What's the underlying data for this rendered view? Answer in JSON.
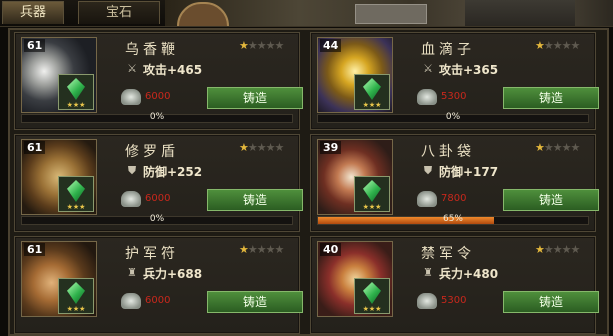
{
  "tabs": [
    {
      "label": "兵器"
    },
    {
      "label": "宝石"
    }
  ],
  "colors": {
    "cost_red": "#c8281c",
    "forge_button": "#3f7a30",
    "progress_orange": "#f08a2c",
    "star_gold": "#e3b73c"
  },
  "items": [
    {
      "name": "乌香鞭",
      "level": "61",
      "stars_lit": 1,
      "stars_total": 5,
      "stat_icon": "attack-icon",
      "stat": "攻击+465",
      "cost": "6000",
      "button": "铸造",
      "progress": "0%",
      "progress_value": 0,
      "gem_stars": "★★★"
    },
    {
      "name": "血滴子",
      "level": "44",
      "stars_lit": 1,
      "stars_total": 5,
      "stat_icon": "attack-icon",
      "stat": "攻击+365",
      "cost": "5300",
      "button": "铸造",
      "progress": "0%",
      "progress_value": 0,
      "gem_stars": "★★★"
    },
    {
      "name": "修罗盾",
      "level": "61",
      "stars_lit": 1,
      "stars_total": 5,
      "stat_icon": "shield-icon",
      "stat": "防御+252",
      "cost": "6000",
      "button": "铸造",
      "progress": "0%",
      "progress_value": 0,
      "gem_stars": "★★★"
    },
    {
      "name": "八卦袋",
      "level": "39",
      "stars_lit": 1,
      "stars_total": 5,
      "stat_icon": "shield-icon",
      "stat": "防御+177",
      "cost": "7800",
      "button": "铸造",
      "progress": "65%",
      "progress_value": 0.65,
      "gem_stars": "★★★"
    },
    {
      "name": "护军符",
      "level": "61",
      "stars_lit": 1,
      "stars_total": 5,
      "stat_icon": "troop-icon",
      "stat": "兵力+688",
      "cost": "6000",
      "button": "铸造",
      "progress": "",
      "progress_value": 0,
      "gem_stars": "★★★"
    },
    {
      "name": "禁军令",
      "level": "40",
      "stars_lit": 1,
      "stars_total": 5,
      "stat_icon": "troop-icon",
      "stat": "兵力+480",
      "cost": "5300",
      "button": "铸造",
      "progress": "",
      "progress_value": 0,
      "gem_stars": "★★★"
    }
  ]
}
